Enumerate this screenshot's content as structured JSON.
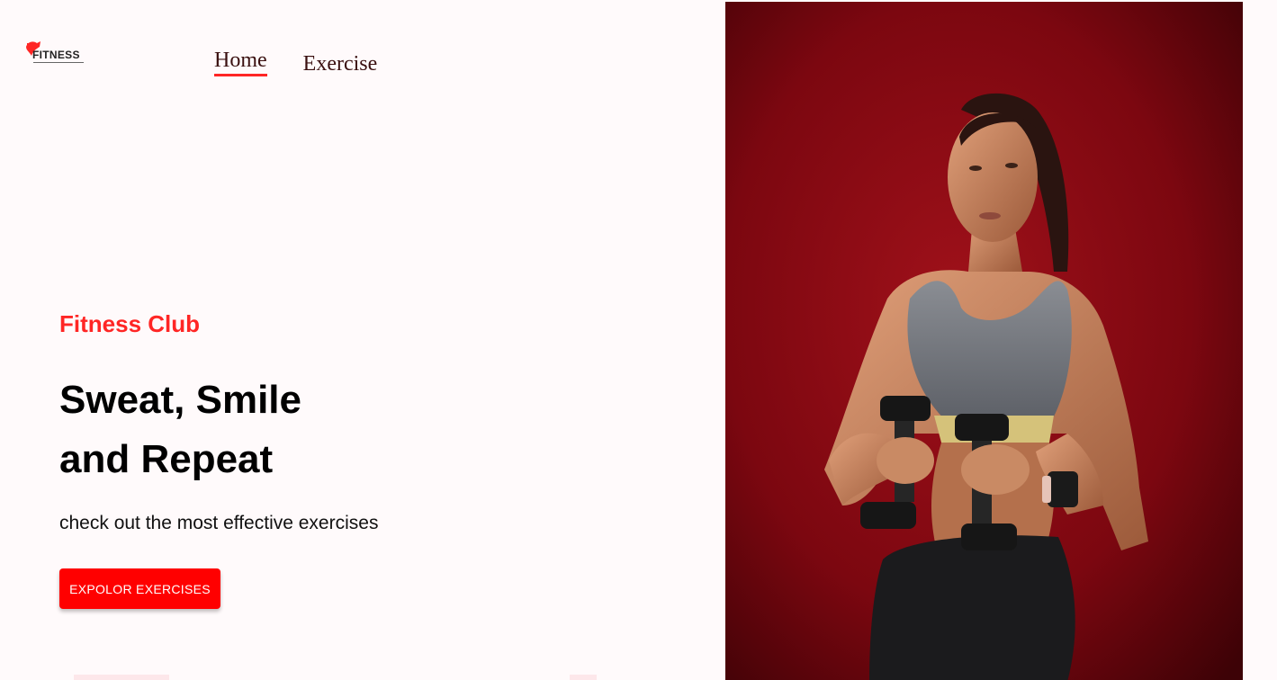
{
  "brand": {
    "logo_text": "FITNESS",
    "accent_color": "#ff2625",
    "logo_icon": "dumbbell-logo-icon"
  },
  "nav": {
    "items": [
      {
        "label": "Home",
        "active": true
      },
      {
        "label": "Exercise",
        "active": false
      }
    ]
  },
  "hero": {
    "kicker": "Fitness Club",
    "title_line1": "Sweat, Smile",
    "title_line2": "and Repeat",
    "subtitle": "check out the most effective exercises",
    "cta_label": "EXPOLOR EXERCISES",
    "cta_color": "#ff0000",
    "image_background_color": "#8b0a0e"
  }
}
